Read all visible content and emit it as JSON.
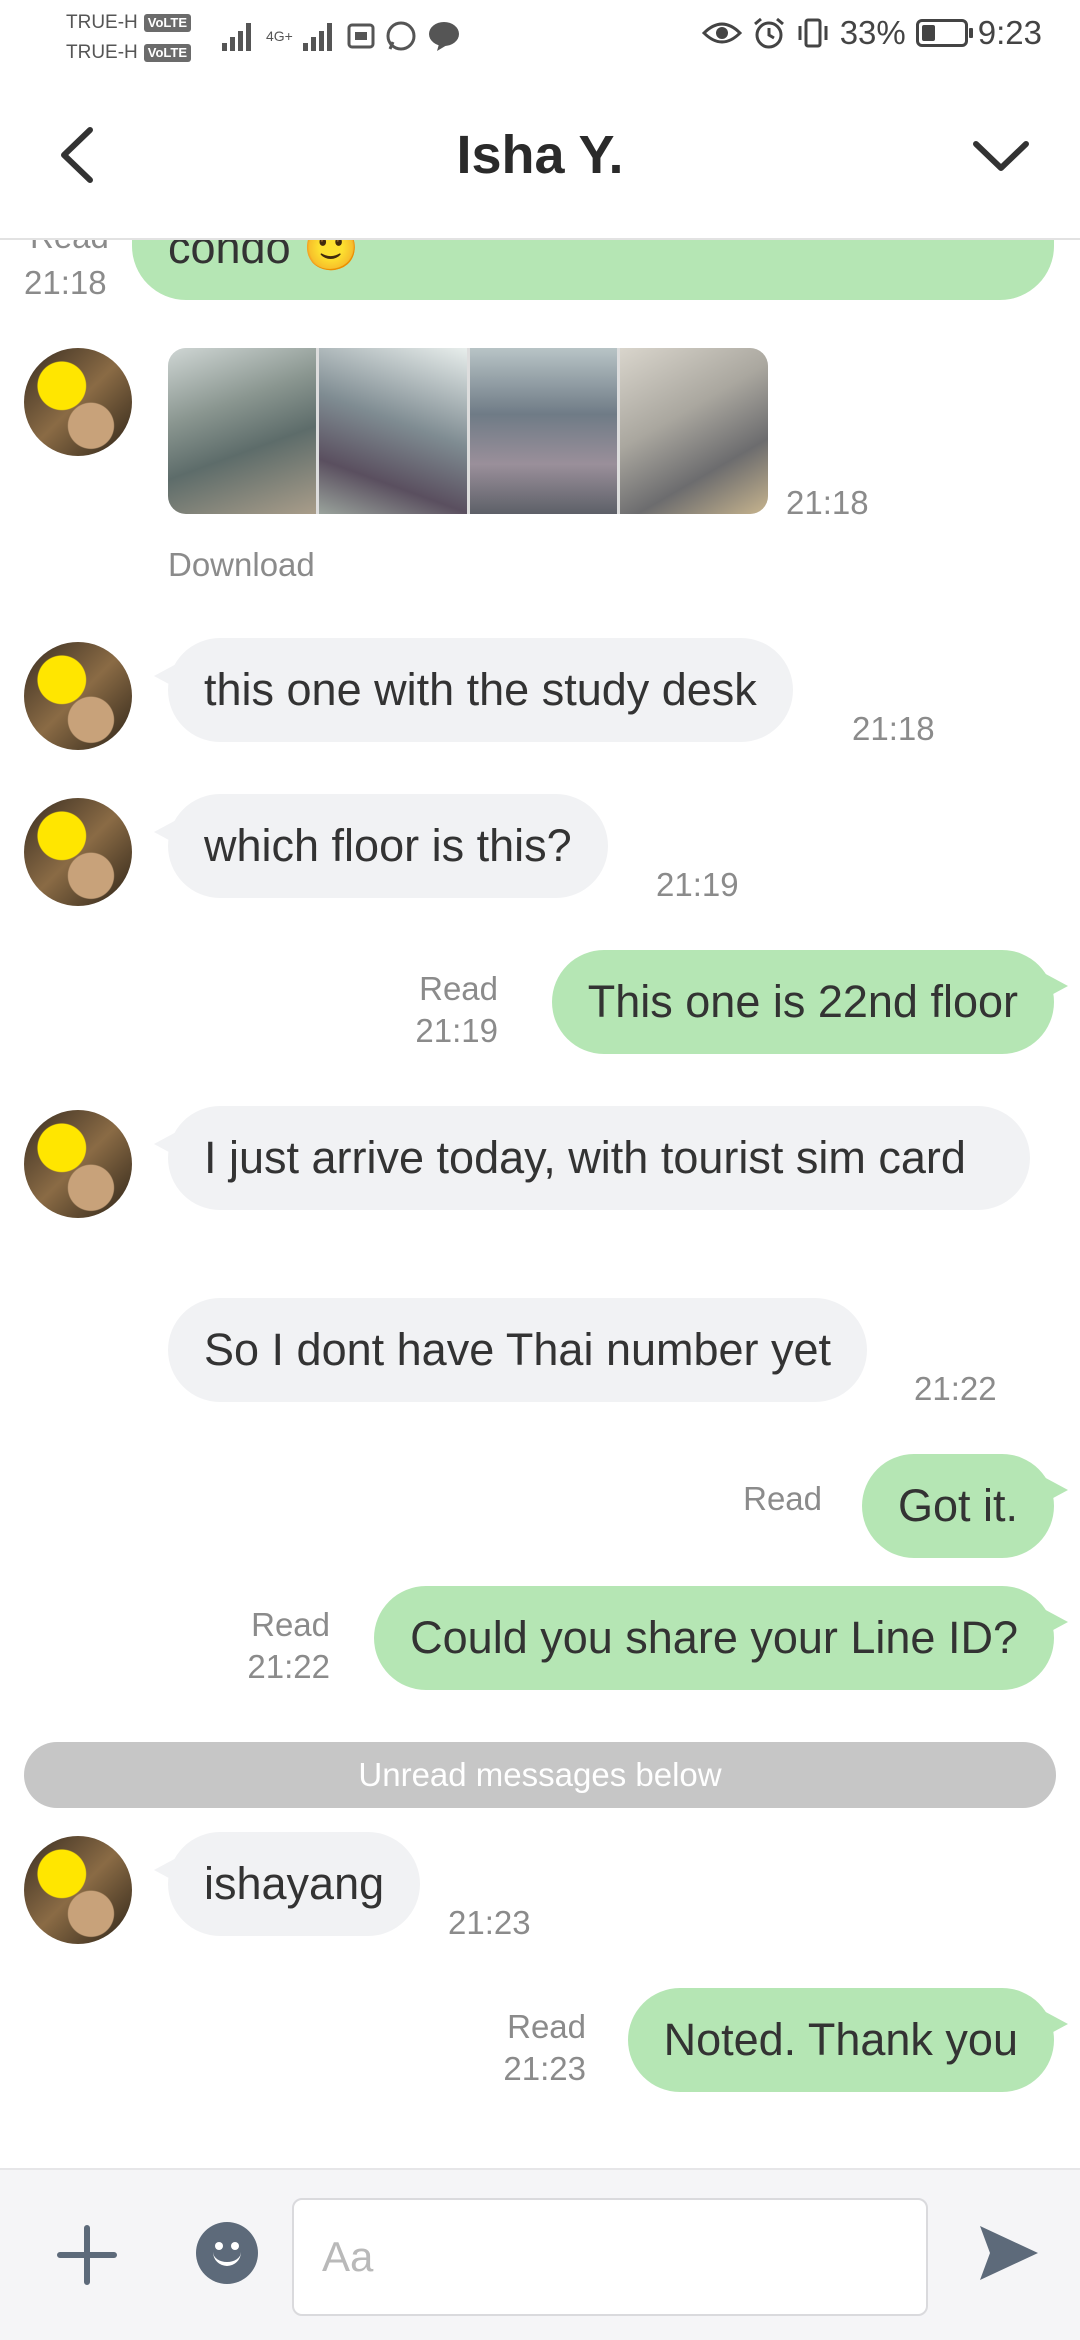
{
  "status_bar": {
    "carrier_1": "TRUE-H",
    "carrier_2": "TRUE-H",
    "volte_badge": "VoLTE",
    "network_label": "4G+",
    "battery_percent": "33%",
    "battery_level": 0.33,
    "time": "9:23"
  },
  "header": {
    "title": "Isha Y."
  },
  "messages": {
    "m0": {
      "text": "condo 🙂",
      "status": "Read",
      "time": "21:18"
    },
    "m1": {
      "time": "21:18",
      "download_label": "Download",
      "photo_count": 4
    },
    "m2": {
      "text": "this one with the study desk",
      "time": "21:18"
    },
    "m3": {
      "text": "which floor is this?",
      "time": "21:19"
    },
    "m4": {
      "text": "This one is 22nd floor",
      "status": "Read",
      "time": "21:19"
    },
    "m5": {
      "text": "I just arrive today, with tourist sim card"
    },
    "m6": {
      "text": "So I dont have Thai number yet",
      "time": "21:22"
    },
    "m7": {
      "text": "Got it.",
      "status": "Read"
    },
    "m8": {
      "text": "Could you share your Line ID?",
      "status": "Read",
      "time": "21:22"
    },
    "unread_divider": "Unread messages below",
    "m9": {
      "text": "ishayang",
      "time": "21:23"
    },
    "m10": {
      "text": "Noted. Thank you",
      "status": "Read",
      "time": "21:23"
    }
  },
  "composer": {
    "placeholder": "Aa"
  },
  "colors": {
    "outgoing_bubble": "#b5e6b4",
    "incoming_bubble": "#f1f2f4",
    "unread_bar": "#c6c6c6",
    "icon_gray": "#5d6a7a"
  }
}
